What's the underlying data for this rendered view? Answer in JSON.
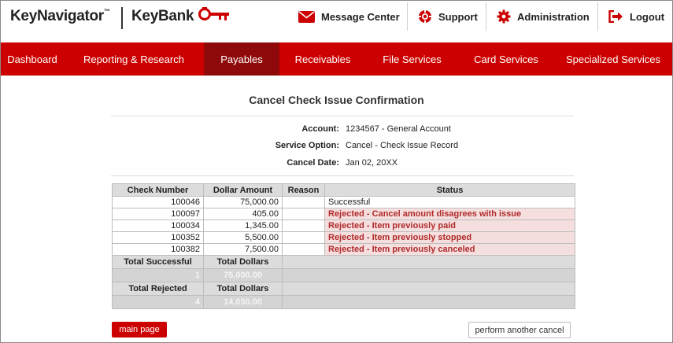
{
  "header": {
    "brand_primary": "KeyNavigator",
    "brand_tm": "™",
    "brand_secondary": "KeyBank",
    "brand_color": "#cc0000",
    "utility_links": [
      {
        "label": "Message Center",
        "icon": "envelope-icon"
      },
      {
        "label": "Support",
        "icon": "lifebuoy-icon"
      },
      {
        "label": "Administration",
        "icon": "gear-icon"
      },
      {
        "label": "Logout",
        "icon": "logout-icon"
      }
    ]
  },
  "nav": {
    "items": [
      {
        "label": "Dashboard",
        "active": false
      },
      {
        "label": "Reporting & Research",
        "active": false
      },
      {
        "label": "Payables",
        "active": true
      },
      {
        "label": "Receivables",
        "active": false
      },
      {
        "label": "File Services",
        "active": false
      },
      {
        "label": "Card Services",
        "active": false
      },
      {
        "label": "Specialized Services",
        "active": false
      }
    ]
  },
  "page": {
    "title": "Cancel Check Issue Confirmation",
    "info": [
      {
        "label": "Account:",
        "value": "1234567 - General Account"
      },
      {
        "label": "Service Option:",
        "value": "Cancel - Check Issue Record"
      },
      {
        "label": "Cancel Date:",
        "value": "Jan 02, 20XX"
      }
    ]
  },
  "table": {
    "headers": [
      "Check Number",
      "Dollar Amount",
      "Reason",
      "Status"
    ],
    "rows": [
      {
        "check_number": "100046",
        "amount": "75,000.00",
        "reason": "",
        "status": "Successful",
        "rejected": false
      },
      {
        "check_number": "100097",
        "amount": "405.00",
        "reason": "",
        "status": "Rejected - Cancel amount disagrees with issue",
        "rejected": true
      },
      {
        "check_number": "100034",
        "amount": "1,345.00",
        "reason": "",
        "status": "Rejected - Item previously paid",
        "rejected": true
      },
      {
        "check_number": "100352",
        "amount": "5,500.00",
        "reason": "",
        "status": "Rejected - Item previously stopped",
        "rejected": true
      },
      {
        "check_number": "100382",
        "amount": "7,500.00",
        "reason": "",
        "status": "Rejected - Item previously canceled",
        "rejected": true
      }
    ],
    "totals": {
      "successful_label": "Total Successful",
      "successful_dollars_label": "Total Dollars",
      "successful_count": "1",
      "successful_dollars": "75,000.00",
      "rejected_label": "Total Rejected",
      "rejected_dollars_label": "Total Dollars",
      "rejected_count": "4",
      "rejected_dollars": "14,050.00"
    }
  },
  "buttons": {
    "main_page": "main page",
    "perform_another_cancel": "perform another cancel"
  }
}
